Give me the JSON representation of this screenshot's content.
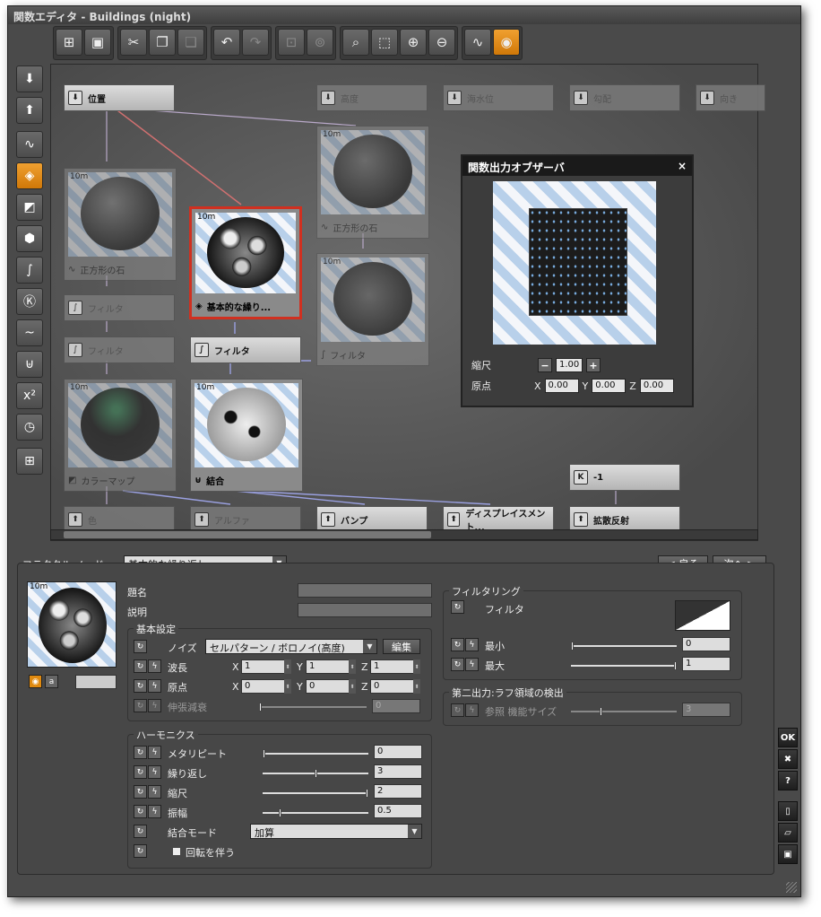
{
  "window": {
    "title": "関数エディタ - Buildings (night)"
  },
  "toolbar": {
    "icons": [
      "graph-node-icon",
      "properties-icon",
      "cut-icon",
      "copy-icon",
      "paste-icon",
      "undo-icon",
      "redo-icon",
      "group-icon",
      "ungroup-icon",
      "zoom-selection-icon",
      "zoom-region-icon",
      "zoom-in-icon",
      "zoom-out-icon",
      "plot-icon",
      "preview-icon"
    ]
  },
  "leftbar": {
    "icons": [
      "input-node-icon",
      "output-node-icon",
      "noise-icon",
      "fractal-icon",
      "colormap-icon",
      "pattern-icon",
      "filter-icon",
      "constant-icon",
      "curve-icon",
      "combiner-icon",
      "power-icon",
      "time-icon",
      "group-node-icon"
    ]
  },
  "nodes": {
    "position": "位置",
    "altitude": "高度",
    "sea_level": "海水位",
    "slope": "勾配",
    "orientation": "向き",
    "square_stone_1": "正方形の石",
    "square_stone_2": "正方形の石",
    "basic_repeat": "基本的な繰り...",
    "filter_1": "フィルタ",
    "filter_2": "フィルタ",
    "filter_3": "フィルタ",
    "filter_4": "フィルタ",
    "colormap": "カラーマップ",
    "combine": "結合",
    "const_value": "-1",
    "color": "色",
    "alpha": "アルファ",
    "bump": "バンプ",
    "displacement": "ディスプレイスメント...",
    "diffuse": "拡散反射",
    "thumb_tag": "10m"
  },
  "observer": {
    "title": "関数出力オブザーバ",
    "close": "×",
    "scale_label": "縮尺",
    "scale": "1.00",
    "origin_label": "原点",
    "x": "0.00",
    "y": "0.00",
    "z": "0.00",
    "xl": "X",
    "yl": "Y",
    "zl": "Z",
    "minus": "−",
    "plus": "+"
  },
  "bottom": {
    "node_label": "フラクタル ノード",
    "node_type": "基本的な繰り返し",
    "back": "< 戻る",
    "next": "次へ >",
    "thumb_tag": "10m",
    "name_label": "題名",
    "desc_label": "説明",
    "basic_group": "基本設定",
    "noise_label": "ノイズ",
    "noise_value": "セルパターン / ボロノイ(高度)",
    "edit": "編集",
    "wave_label": "波長",
    "wave_x": "1",
    "wave_y": "1",
    "wave_z": "1",
    "origin_label": "原点",
    "origin_x": "0",
    "origin_y": "0",
    "origin_z": "0",
    "stretch_label": "伸張減衰",
    "stretch_value": "0",
    "harm_group": "ハーモニクス",
    "lacunarity_label": "メタリピート",
    "lacunarity": "0",
    "repeat_label": "繰り返し",
    "repeat": "3",
    "scale_label": "縮尺",
    "scale": "2",
    "amp_label": "振幅",
    "amp": "0.5",
    "combine_label": "結合モード",
    "combine_value": "加算",
    "rotate_label": "回転を伴う",
    "filter_group": "フィルタリング",
    "filter_label": "フィルタ",
    "min_label": "最小",
    "min": "0",
    "max_label": "最大",
    "max": "1",
    "second_group": "第二出力:ラフ領域の検出",
    "ref_label": "参照 機能サイズ",
    "ref": "3",
    "xl": "X",
    "yl": "Y",
    "zl": "Z"
  },
  "right_buttons": {
    "ok": "OK",
    "cancel": "✖",
    "help": "?"
  }
}
